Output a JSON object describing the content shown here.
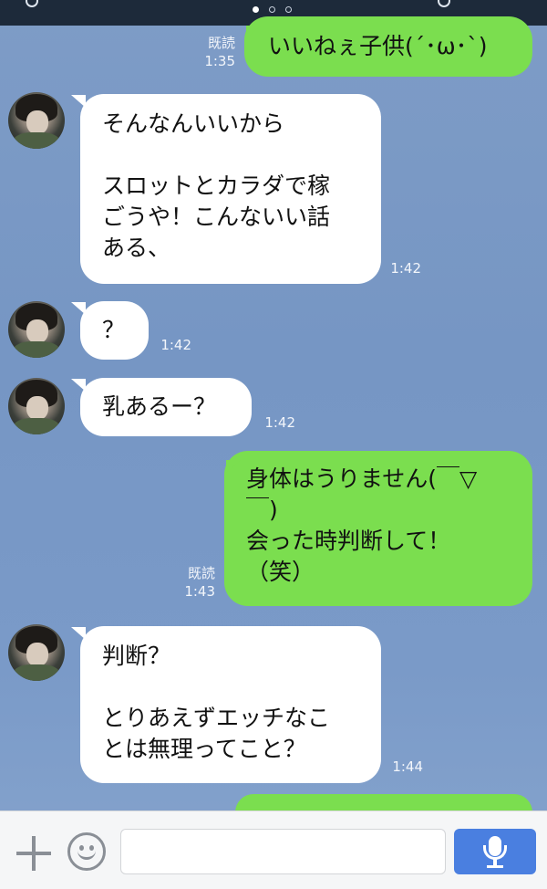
{
  "status_bar": {
    "page_dots": 3,
    "active_dot": 0
  },
  "messages": [
    {
      "id": "m1",
      "side": "out",
      "text": "いいねぇ子供(´･ω･`)",
      "read": "既読",
      "time": "1:35"
    },
    {
      "id": "m2",
      "side": "in",
      "text": "そんなんいいから\n\nスロットとカラダで稼\nごうや！こんないい話\nある、",
      "time": "1:42"
    },
    {
      "id": "m3",
      "side": "in",
      "text": "？",
      "time": "1:42"
    },
    {
      "id": "m4",
      "side": "in",
      "text": "乳あるー？",
      "time": "1:42"
    },
    {
      "id": "m5",
      "side": "out",
      "text": "身体はうりません(￣▽\n￣)\n会った時判断して！\n（笑）",
      "read": "既読",
      "time": "1:43"
    },
    {
      "id": "m6",
      "side": "in",
      "text": "判断？\n\nとりあえずエッチなこ\nとは無理ってこと？",
      "time": "1:44"
    },
    {
      "id": "m7",
      "side": "out",
      "text": ""
    }
  ],
  "input_bar": {
    "text_value": ""
  },
  "colors": {
    "outgoing_bubble": "#7bde4f",
    "incoming_bubble": "#ffffff",
    "background": "#7696c4",
    "send_button": "#4a7fe0"
  },
  "icons": {
    "attach": "plus-icon",
    "sticker": "smiley-icon",
    "voice": "microphone-icon"
  }
}
